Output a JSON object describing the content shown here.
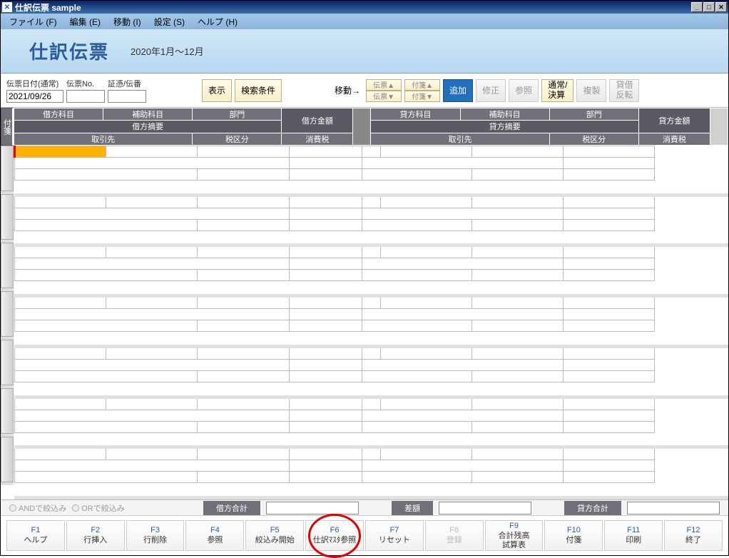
{
  "window": {
    "title": "仕訳伝票 sample"
  },
  "menus": [
    "ファイル (F)",
    "編集 (E)",
    "移動 (I)",
    "設定 (S)",
    "ヘルプ (H)"
  ],
  "header": {
    "sheet_title": "仕訳伝票",
    "period": "2020年1月～12月"
  },
  "controls": {
    "date_label": "伝票日付(通常)",
    "date_value": "2021/09/26",
    "denpyo_no_label": "伝票No.",
    "denpyo_no_value": "",
    "shohyo_label": "証憑/伝番",
    "shohyo_value": "",
    "show_btn": "表示",
    "search_btn": "検索条件",
    "move_label": "移動→",
    "mini_btns": [
      "伝票▲",
      "付箋▲",
      "伝票▼",
      "付箋▼"
    ],
    "add_btn": "追加",
    "edit_btn": "修正",
    "ref_btn": "参照",
    "type_btn": "通常/\n決算",
    "copy_btn": "複製",
    "rev_btn": "貸借\n反転"
  },
  "grid_headers": {
    "sticky": "付箋",
    "r1": [
      "借方科目",
      "補助科目",
      "部門",
      "",
      "貸方科目",
      "補助科目",
      "部門",
      ""
    ],
    "r2": [
      "借方摘要",
      "借方金額",
      "貸方摘要",
      "貸方金額"
    ],
    "r3": [
      "取引先",
      "税区分",
      "消費税",
      "取引先",
      "税区分",
      "消費税"
    ]
  },
  "totals": {
    "and_label": "ANDで絞込み",
    "or_label": "ORで絞込み",
    "debit_label": "借方合計",
    "diff_label": "差額",
    "credit_label": "貸方合計"
  },
  "fkeys": [
    {
      "fn": "F1",
      "label": "ヘルプ",
      "disabled": false
    },
    {
      "fn": "F2",
      "label": "行挿入",
      "disabled": false
    },
    {
      "fn": "F3",
      "label": "行削除",
      "disabled": false
    },
    {
      "fn": "F4",
      "label": "参照",
      "disabled": false
    },
    {
      "fn": "F5",
      "label": "絞込み開始",
      "disabled": false
    },
    {
      "fn": "F6",
      "label": "仕訳ﾏｽﾀ参照",
      "disabled": false,
      "circled": true
    },
    {
      "fn": "F7",
      "label": "リセット",
      "disabled": false
    },
    {
      "fn": "F8",
      "label": "登録",
      "disabled": true
    },
    {
      "fn": "F9",
      "label": "合計残高\n試算表",
      "disabled": false
    },
    {
      "fn": "F10",
      "label": "付箋",
      "disabled": false
    },
    {
      "fn": "F11",
      "label": "印刷",
      "disabled": false
    },
    {
      "fn": "F12",
      "label": "終了",
      "disabled": false
    }
  ]
}
